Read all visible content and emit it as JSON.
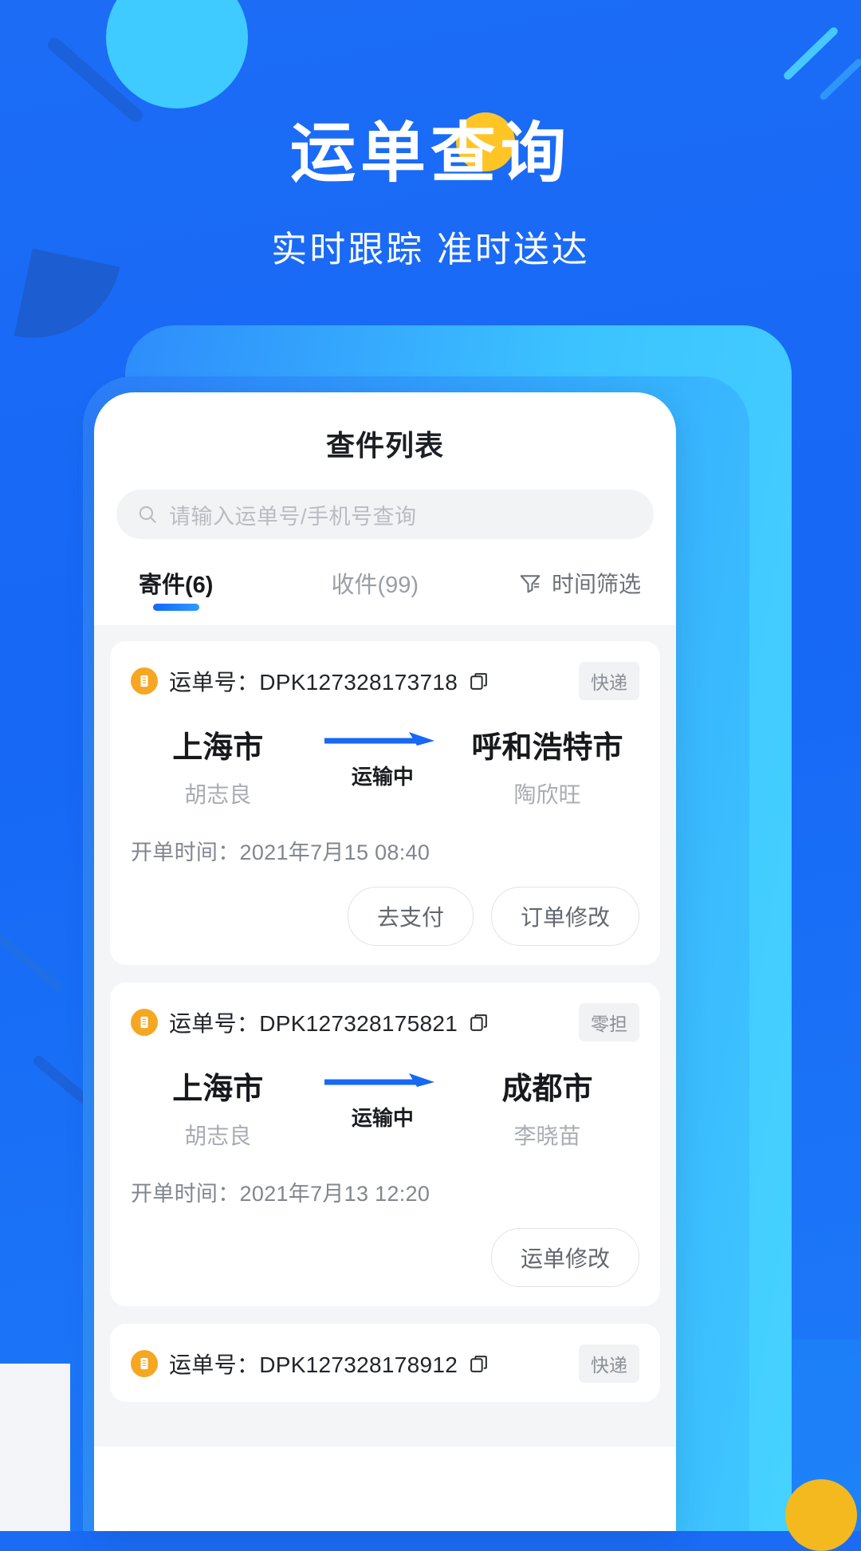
{
  "hero": {
    "title": "运单查询",
    "subtitle": "实时跟踪 准时送达"
  },
  "colors": {
    "brand_blue": "#1668F5",
    "cyan": "#3FC6FF",
    "accent_orange": "#F5A623",
    "yellow_dot": "#FFC526",
    "page_bg": "#F4F5F7"
  },
  "card": {
    "title": "查件列表"
  },
  "search": {
    "placeholder": "请输入运单号/手机号查询",
    "value": "",
    "icon": "search-icon"
  },
  "tabs": {
    "items": [
      {
        "label": "寄件(6)",
        "active": true
      },
      {
        "label": "收件(99)",
        "active": false
      }
    ],
    "filter": {
      "label": "时间筛选",
      "icon": "filter-funnel-icon"
    }
  },
  "orders": [
    {
      "no_label": "运单号：",
      "no": "DPK127328173718",
      "badge": "快递",
      "origin_city": "上海市",
      "origin_person": "胡志良",
      "status": "运输中",
      "dest_city": "呼和浩特市",
      "dest_person": "陶欣旺",
      "time_label": "开单时间：",
      "time": "2021年7月15 08:40",
      "actions": [
        "去支付",
        "订单修改"
      ]
    },
    {
      "no_label": "运单号：",
      "no": "DPK127328175821",
      "badge": "零担",
      "origin_city": "上海市",
      "origin_person": "胡志良",
      "status": "运输中",
      "dest_city": "成都市",
      "dest_person": "李晓苗",
      "time_label": "开单时间：",
      "time": "2021年7月13 12:20",
      "actions": [
        "运单修改"
      ]
    },
    {
      "no_label": "运单号：",
      "no": "DPK127328178912",
      "badge": "快递",
      "origin_city": "",
      "origin_person": "",
      "status": "",
      "dest_city": "",
      "dest_person": "",
      "time_label": "",
      "time": "",
      "actions": []
    }
  ]
}
